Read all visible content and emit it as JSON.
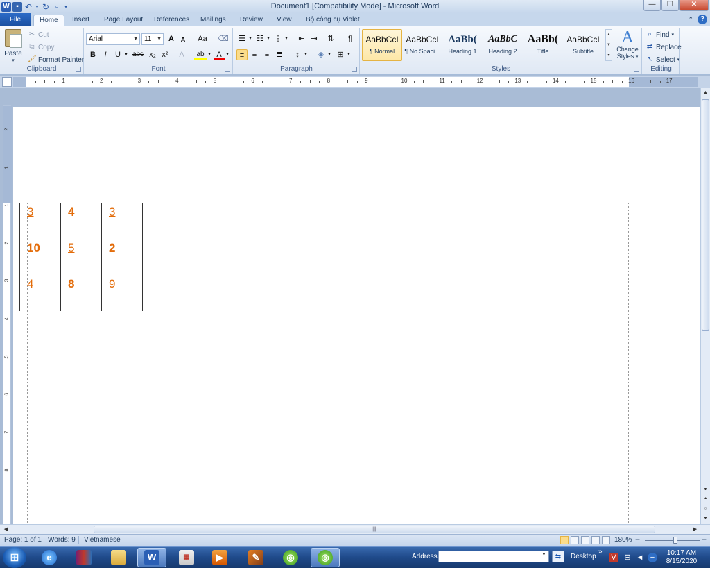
{
  "window": {
    "title": "Document1 [Compatibility Mode]  -  Microsoft Word",
    "word_icon_letter": "W"
  },
  "ribbon_tabs": [
    "File",
    "Home",
    "Insert",
    "Page Layout",
    "References",
    "Mailings",
    "Review",
    "View",
    "Bộ công cụ Violet"
  ],
  "active_tab": "Home",
  "clipboard": {
    "paste": "Paste",
    "cut": "Cut",
    "copy": "Copy",
    "format_painter": "Format Painter",
    "label": "Clipboard"
  },
  "font": {
    "family": "Arial",
    "size": "11",
    "label": "Font",
    "bold": "B",
    "italic": "I",
    "underline": "U",
    "strike": "abc",
    "subscript": "x₂",
    "superscript": "x²",
    "grow": "A",
    "shrink": "A",
    "change_case": "Aa",
    "font_color_glyph": "A",
    "highlight_glyph": "ab"
  },
  "paragraph": {
    "label": "Paragraph",
    "pilcrow": "¶"
  },
  "styles": {
    "label": "Styles",
    "items": [
      {
        "preview": "AaBbCcI",
        "name": "¶ Normal"
      },
      {
        "preview": "AaBbCcI",
        "name": "¶ No Spaci..."
      },
      {
        "preview": "AaBb(",
        "name": "Heading 1"
      },
      {
        "preview": "AaBbC",
        "name": "Heading 2"
      },
      {
        "preview": "AaBb(",
        "name": "Title"
      },
      {
        "preview": "AaBbCcI",
        "name": "Subtitle"
      }
    ],
    "selected_index": 0,
    "change_styles_line1": "Change",
    "change_styles_line2": "Styles",
    "change_styles_glyph": "A"
  },
  "editing": {
    "label": "Editing",
    "find": "Find",
    "replace": "Replace",
    "select": "Select"
  },
  "ruler_numbers": [
    "1",
    "2",
    "3",
    "4",
    "5",
    "6",
    "7",
    "8",
    "9",
    "10",
    "11",
    "12",
    "13",
    "14",
    "15",
    "16",
    "17"
  ],
  "vruler_numbers": [
    "2",
    "1",
    "1",
    "2",
    "3",
    "4",
    "5",
    "6",
    "7",
    "8"
  ],
  "table": {
    "rows": [
      [
        {
          "text": "3",
          "style": "link"
        },
        {
          "text": "4",
          "style": "bold"
        },
        {
          "text": "3",
          "style": "link"
        }
      ],
      [
        {
          "text": "10",
          "style": "bold"
        },
        {
          "text": "5",
          "style": "link"
        },
        {
          "text": "2",
          "style": "bold"
        }
      ],
      [
        {
          "text": "4",
          "style": "link"
        },
        {
          "text": "8",
          "style": "bold"
        },
        {
          "text": "9",
          "style": "link"
        }
      ]
    ],
    "text_color": "#e36c0a"
  },
  "status": {
    "page": "Page: 1 of 1",
    "words": "Words: 9",
    "language": "Vietnamese",
    "zoom": "180%",
    "zoom_minus": "−",
    "zoom_plus": "+"
  },
  "taskbar": {
    "address_label": "Address",
    "address_value": "",
    "desktop_label": "Desktop",
    "time": "10:17 AM",
    "date": "8/15/2020",
    "apps": [
      "ie-icon",
      "winrar-icon",
      "explorer-icon",
      "word-icon",
      "app5-icon",
      "media-player-icon",
      "app7-icon",
      "app8-icon",
      "app9-icon"
    ]
  },
  "colors": {
    "accent_orange": "#e36c0a",
    "file_tab_blue": "#2b6bc7",
    "selected_yellow": "#fbdc8b"
  }
}
